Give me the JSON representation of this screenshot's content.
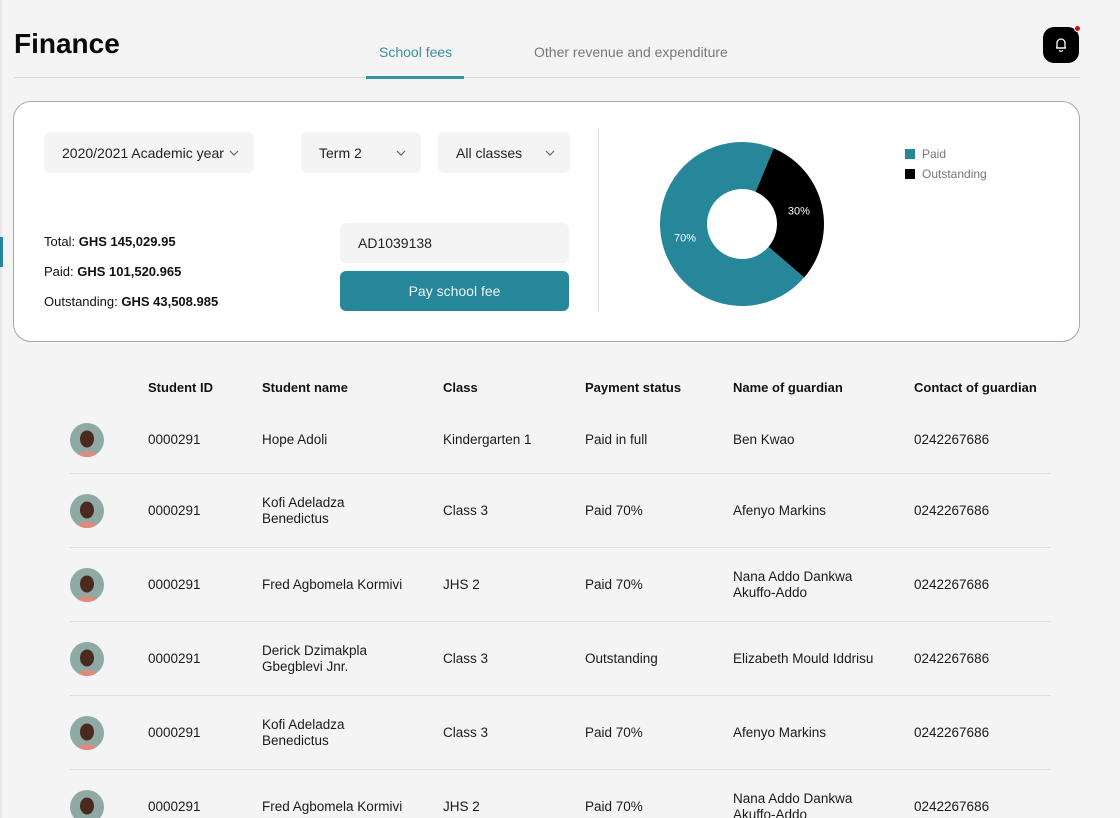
{
  "header": {
    "title": "Finance",
    "tabs": [
      {
        "label": "School fees",
        "active": true
      },
      {
        "label": "Other revenue and expenditure",
        "active": false
      }
    ],
    "notification_icon": "bell-icon",
    "has_unread_notification": true
  },
  "filters": {
    "academic_year": "2020/2021 Academic year",
    "term": "Term 2",
    "class": "All classes"
  },
  "summary": {
    "total_label": "Total:",
    "total_value": "GHS 145,029.95",
    "paid_label": "Paid:",
    "paid_value": "GHS 101,520.965",
    "outstanding_label": "Outstanding:",
    "outstanding_value": "GHS 43,508.985"
  },
  "payment": {
    "student_id_value": "AD1039138",
    "pay_button_label": "Pay school fee"
  },
  "colors": {
    "accent": "#26879a",
    "paid": "#26879a",
    "outstanding": "#000000",
    "notification_dot": "#d10f0f"
  },
  "chart_data": {
    "type": "pie",
    "variant": "donut",
    "title": "",
    "categories": [
      "Paid",
      "Outstanding"
    ],
    "values": [
      70,
      30
    ],
    "data_labels": [
      "70%",
      "30%"
    ],
    "colors": [
      "#26879a",
      "#000000"
    ],
    "legend": [
      "Paid",
      "Outstanding"
    ],
    "legend_position": "right"
  },
  "table": {
    "columns": [
      "Student ID",
      "Student name",
      "Class",
      "Payment status",
      "Name of guardian",
      "Contact of guardian"
    ],
    "rows": [
      {
        "id": "0000291",
        "name": "Hope Adoli",
        "class": "Kindergarten 1",
        "status": "Paid in full",
        "guardian": "Ben Kwao",
        "contact": "0242267686"
      },
      {
        "id": "0000291",
        "name": "Kofi Adeladza Benedictus",
        "class": "Class 3",
        "status": "Paid 70%",
        "guardian": "Afenyo Markins",
        "contact": "0242267686"
      },
      {
        "id": "0000291",
        "name": "Fred Agbomela Kormivi",
        "class": "JHS 2",
        "status": "Paid 70%",
        "guardian": "Nana Addo Dankwa Akuffo-Addo",
        "contact": "0242267686"
      },
      {
        "id": "0000291",
        "name": "Derick Dzimakpla Gbegblevi Jnr.",
        "class": "Class 3",
        "status": "Outstanding",
        "guardian": "Elizabeth Mould Iddrisu",
        "contact": "0242267686"
      },
      {
        "id": "0000291",
        "name": "Kofi Adeladza Benedictus",
        "class": "Class 3",
        "status": "Paid 70%",
        "guardian": "Afenyo Markins",
        "contact": "0242267686"
      },
      {
        "id": "0000291",
        "name": "Fred Agbomela Kormivi",
        "class": "JHS 2",
        "status": "Paid 70%",
        "guardian": "Nana Addo Dankwa Akuffo-Addo",
        "contact": "0242267686"
      }
    ]
  }
}
